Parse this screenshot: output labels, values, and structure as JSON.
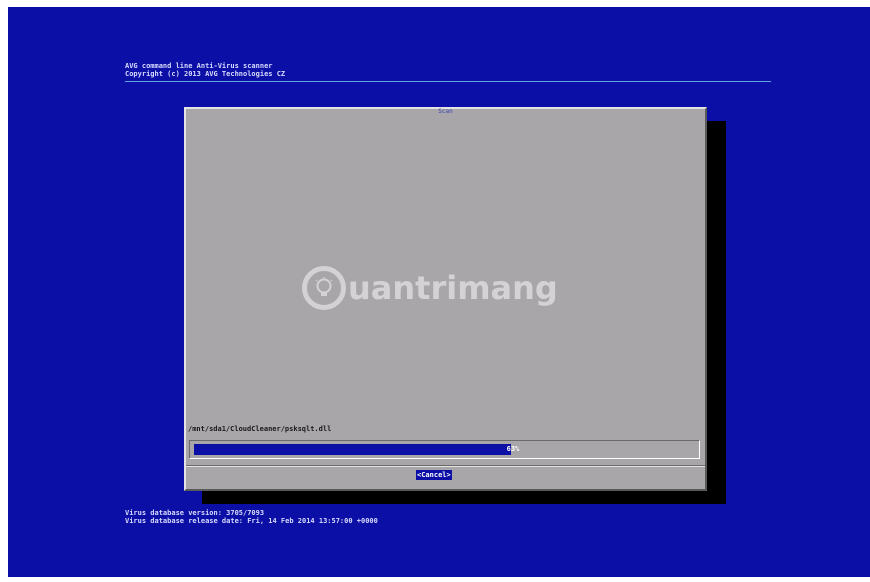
{
  "header": {
    "line1": "AVG command line Anti-Virus scanner",
    "line2": "Copyright (c) 2013 AVG Technologies CZ"
  },
  "dialog": {
    "title": "Scan",
    "current_file": "/mnt/sda1/CloudCleaner/psksqlt.dll",
    "progress": {
      "percent": 63,
      "label": "63%"
    },
    "cancel_label": "<Cancel>"
  },
  "watermark": {
    "text": "uantrimang",
    "icon": "lightbulb-icon"
  },
  "footer": {
    "line1": "Virus database version: 3705/7093",
    "line2": "Virus database release date: Fri, 14 Feb 2014 13:57:00 +0000"
  },
  "colors": {
    "background": "#0b0fa5",
    "dialog": "#a8a6a8",
    "progress_fill": "#0b0fa5",
    "text": "#d7dbff"
  }
}
